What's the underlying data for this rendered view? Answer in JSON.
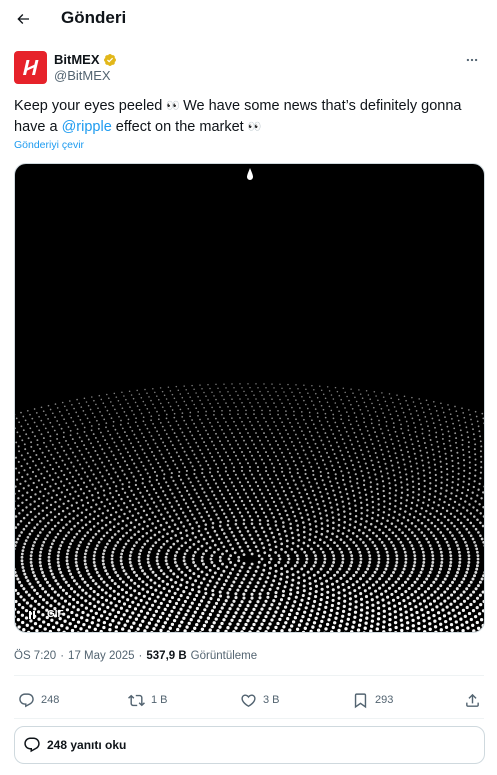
{
  "header": {
    "title": "Gönderi"
  },
  "author": {
    "name": "BitMEX",
    "handle": "@BitMEX"
  },
  "tweet": {
    "text_before": "Keep your eyes peeled ",
    "text_middle_1": " We have some news that’s definitely gonna have a ",
    "mention": "@ripple",
    "text_after": " effect on the market ",
    "eyes_emoji": "👀",
    "translate_label": "Gönderiyi çevir"
  },
  "media": {
    "badge": "GIF"
  },
  "meta": {
    "time": "ÖS 7:20",
    "separator": "·",
    "date": "17 May 2025",
    "views_count": "537,9 B",
    "views_label": "Görüntüleme"
  },
  "actions": {
    "replies": "248",
    "reposts": "1 B",
    "likes": "3 B",
    "bookmarks": "293"
  },
  "read_replies": {
    "label": "248 yanıtı oku"
  },
  "colors": {
    "accent": "#1d9bf0",
    "verified": "#e2b719",
    "brand": "#e6222a"
  }
}
